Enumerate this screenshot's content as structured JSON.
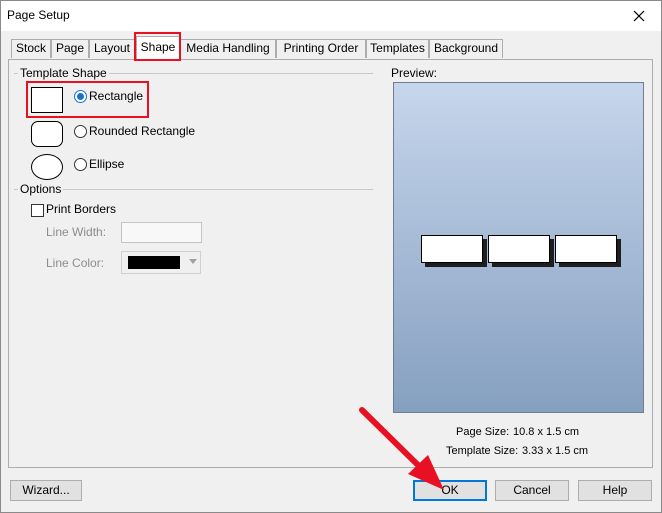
{
  "window": {
    "title": "Page Setup"
  },
  "tabs": [
    {
      "label": "Stock"
    },
    {
      "label": "Page"
    },
    {
      "label": "Layout"
    },
    {
      "label": "Shape"
    },
    {
      "label": "Media Handling"
    },
    {
      "label": "Printing Order"
    },
    {
      "label": "Templates"
    },
    {
      "label": "Background"
    }
  ],
  "active_tab": "Shape",
  "template_shape": {
    "group_label": "Template Shape",
    "options": [
      {
        "label": "Rectangle",
        "checked": true
      },
      {
        "label": "Rounded Rectangle",
        "checked": false
      },
      {
        "label": "Ellipse",
        "checked": false
      }
    ]
  },
  "options_group": {
    "group_label": "Options",
    "print_borders_label": "Print Borders",
    "print_borders_checked": false,
    "line_width_label": "Line Width:",
    "line_width_value": "",
    "line_color_label": "Line Color:",
    "line_color_value": "#000000"
  },
  "preview": {
    "label": "Preview:",
    "page_size_label": "Page Size:",
    "page_size_value": "10.8 x 1.5 cm",
    "template_size_label": "Template Size:",
    "template_size_value": "3.33 x 1.5 cm"
  },
  "buttons": {
    "wizard": "Wizard...",
    "ok": "OK",
    "cancel": "Cancel",
    "help": "Help"
  },
  "colors": {
    "highlight": "#e81123",
    "accent": "#0078d7"
  },
  "icons": {
    "close": "close-icon"
  }
}
